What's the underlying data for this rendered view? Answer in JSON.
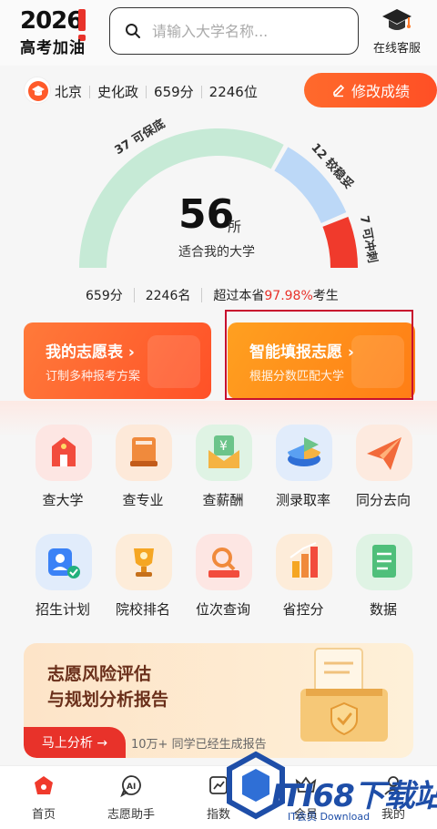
{
  "header": {
    "logo_year": "2026",
    "logo_text": "高考加油",
    "search_placeholder": "请输入大学名称...",
    "service_label": "在线客服"
  },
  "profile": {
    "province": "北京",
    "subjects": "史化政",
    "score": "659分",
    "rank": "2246位",
    "edit_label": "修改成绩"
  },
  "gauge": {
    "count": "56",
    "unit": "所",
    "caption": "适合我的大学",
    "segments": [
      {
        "label": "37 可保底",
        "value": 37,
        "color": "#c6ead6"
      },
      {
        "label": "12 较稳妥",
        "value": 12,
        "color": "#bcd8f7"
      },
      {
        "label": "7 可冲刺",
        "value": 7,
        "color": "#f03a2c"
      }
    ]
  },
  "stats": {
    "score": "659分",
    "rank": "2246名",
    "exceed_prefix": "超过本省",
    "exceed_pct": "97.98%",
    "exceed_suffix": "考生"
  },
  "cards": [
    {
      "title": "我的志愿表 ›",
      "sub": "订制多种报考方案"
    },
    {
      "title": "智能填报志愿 ›",
      "sub": "根据分数匹配大学"
    }
  ],
  "grid": [
    {
      "label": "查大学",
      "icon": "school-icon",
      "bg": "#fde6e3"
    },
    {
      "label": "查专业",
      "icon": "book-icon",
      "bg": "#fde9d9"
    },
    {
      "label": "查薪酬",
      "icon": "salary-envelope-icon",
      "bg": "#dff3e4"
    },
    {
      "label": "测录取率",
      "icon": "pie-chart-icon",
      "bg": "#e1ecfb"
    },
    {
      "label": "同分去向",
      "icon": "paper-plane-icon",
      "bg": "#fdeadf"
    },
    {
      "label": "招生计划",
      "icon": "user-check-icon",
      "bg": "#e1ecfb"
    },
    {
      "label": "院校排名",
      "icon": "trophy-icon",
      "bg": "#fdecd9"
    },
    {
      "label": "位次查询",
      "icon": "magnifier-icon",
      "bg": "#fde6e3"
    },
    {
      "label": "省控分",
      "icon": "bar-chart-icon",
      "bg": "#fdecd9"
    },
    {
      "label": "数据",
      "icon": "notebook-icon",
      "bg": "#dff3e4"
    }
  ],
  "banner": {
    "title": "志愿风险评估\n与规划分析报告",
    "button": "马上分析 →",
    "note": "10万+ 同学已经生成报告"
  },
  "tabs": [
    {
      "label": "首页",
      "icon": "home-icon"
    },
    {
      "label": "志愿助手",
      "icon": "ai-assistant-icon"
    },
    {
      "label": "指数",
      "icon": "index-icon"
    },
    {
      "label": "会员",
      "icon": "vip-icon"
    },
    {
      "label": "我的",
      "icon": "profile-icon"
    }
  ],
  "watermark": {
    "text": "ITI68下载站",
    "sub": "IT会员 Download"
  }
}
